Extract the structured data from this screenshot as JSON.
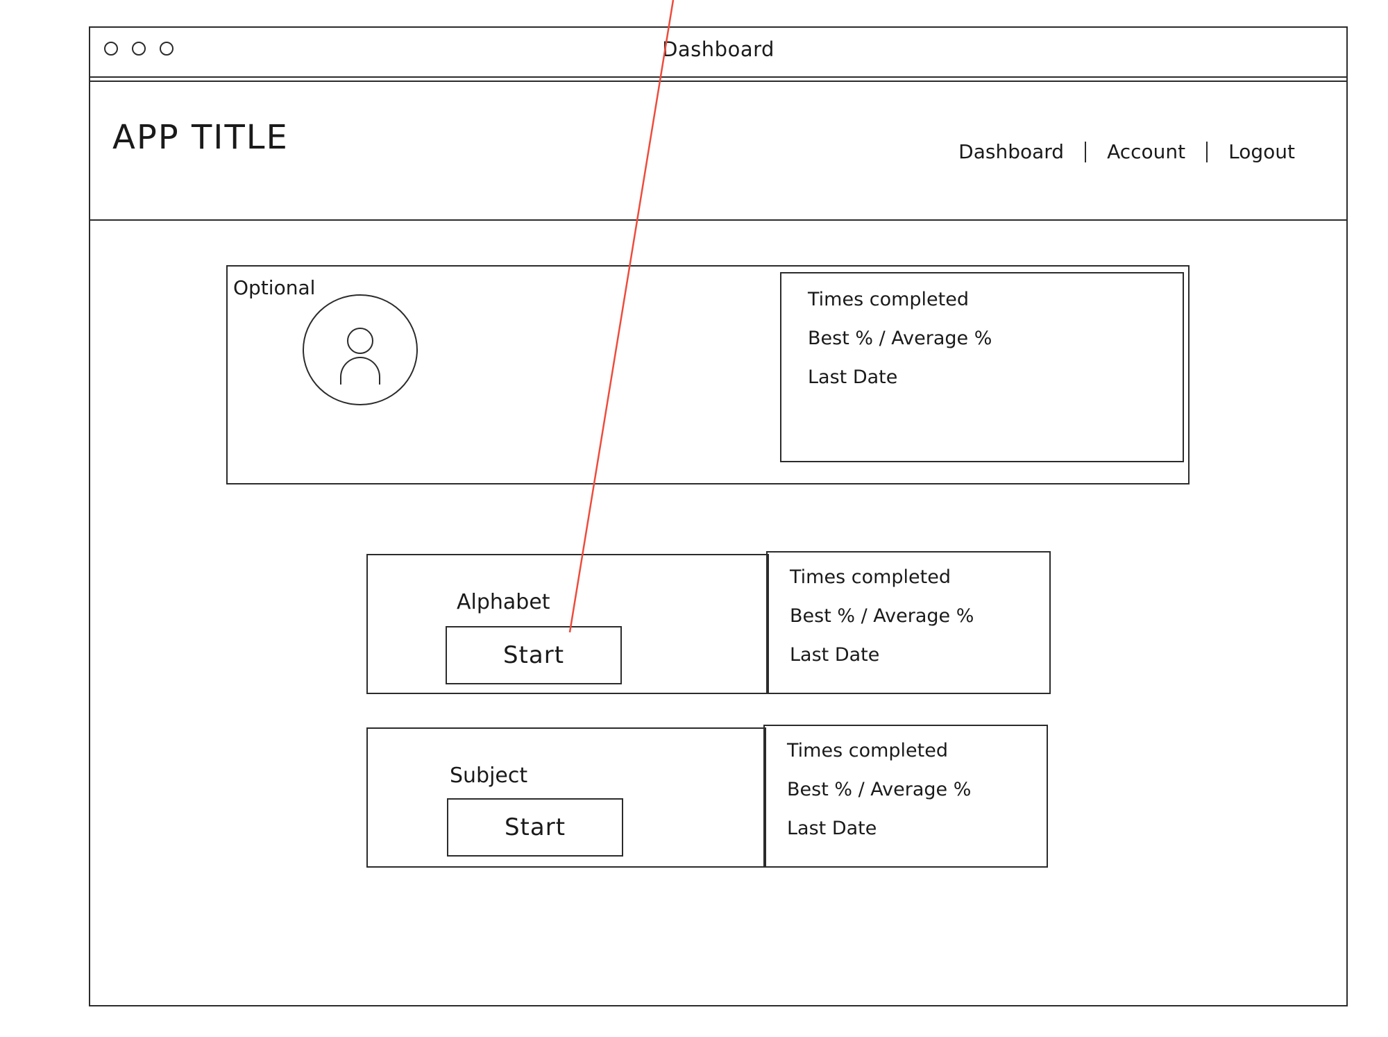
{
  "window": {
    "title": "Dashboard"
  },
  "header": {
    "app_title": "APP TITLE",
    "nav": [
      {
        "label": "Dashboard"
      },
      {
        "label": "Account"
      },
      {
        "label": "Logout"
      }
    ]
  },
  "profile": {
    "optional_label": "Optional",
    "stats": {
      "times_completed": "Times completed",
      "best_average": "Best % / Average %",
      "last_date": "Last Date"
    }
  },
  "quizzes": [
    {
      "label": "Alphabet",
      "start_label": "Start",
      "stats": {
        "times_completed": "Times completed",
        "best_average": "Best % / Average %",
        "last_date": "Last Date"
      }
    },
    {
      "label": "Subject",
      "start_label": "Start",
      "stats": {
        "times_completed": "Times completed",
        "best_average": "Best % / Average %",
        "last_date": "Last Date"
      }
    }
  ],
  "colors": {
    "annotation_line": "#ee4b3b",
    "stroke": "#2b2b2b"
  }
}
